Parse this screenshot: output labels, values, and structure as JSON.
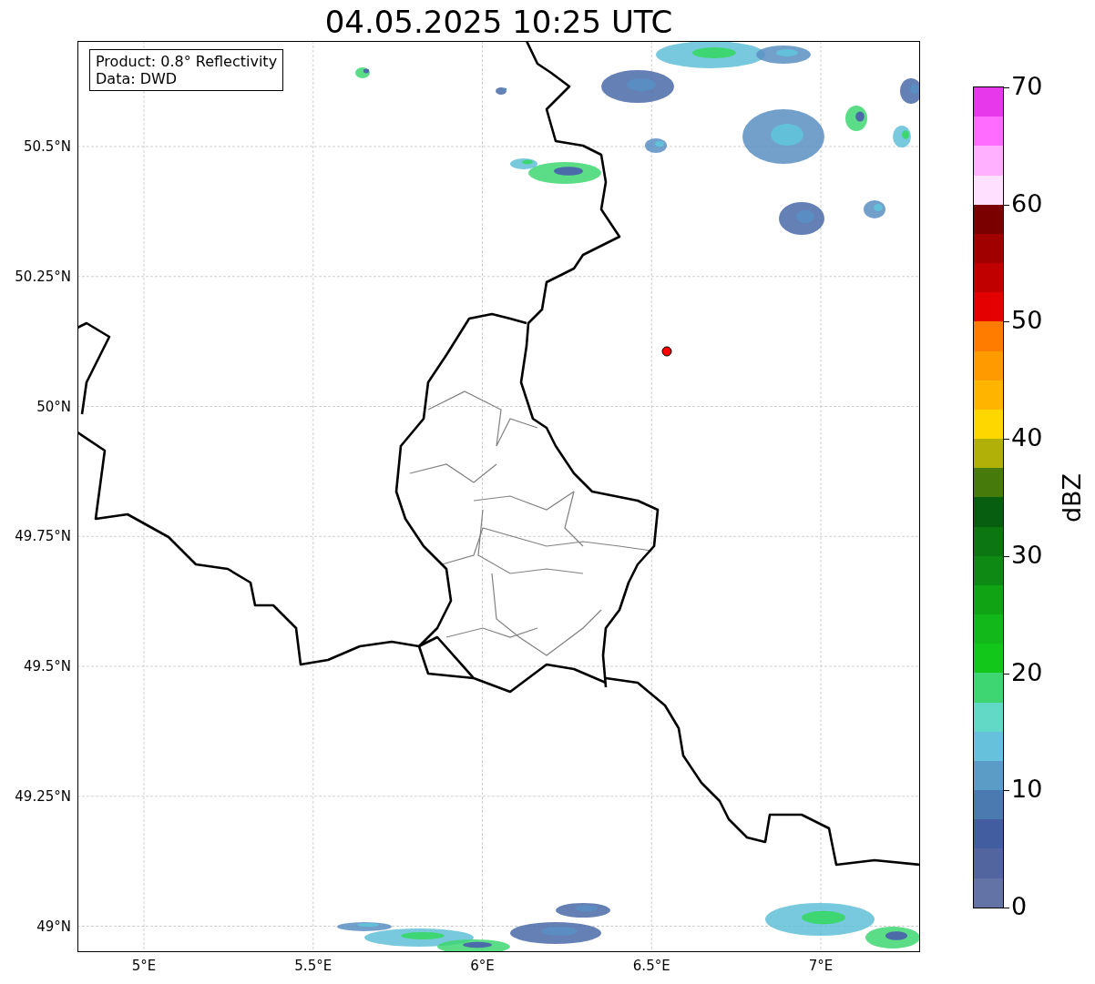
{
  "title": "04.05.2025 10:25 UTC",
  "info_box": {
    "lines": [
      "Product: 0.8° Reflectivity",
      "Data: DWD"
    ]
  },
  "y_ticks": [
    "50.5°N",
    "50.25°N",
    "50°N",
    "49.75°N",
    "49.5°N",
    "49.25°N",
    "49°N"
  ],
  "x_ticks": [
    "5°E",
    "5.5°E",
    "6°E",
    "6.5°E",
    "7°E"
  ],
  "colorbar": {
    "label": "dBZ",
    "ticks": [
      "70",
      "60",
      "50",
      "40",
      "30",
      "20",
      "10",
      "0"
    ],
    "bins": [
      {
        "color": "#6473a6"
      },
      {
        "color": "#52659f"
      },
      {
        "color": "#435ea0"
      },
      {
        "color": "#4a7ab0"
      },
      {
        "color": "#5b9cc7"
      },
      {
        "color": "#66c2dc"
      },
      {
        "color": "#62d8c6"
      },
      {
        "color": "#3ed672"
      },
      {
        "color": "#12c61a"
      },
      {
        "color": "#12b81a"
      },
      {
        "color": "#10a414"
      },
      {
        "color": "#0e8a14"
      },
      {
        "color": "#0b7612"
      },
      {
        "color": "#085e10"
      },
      {
        "color": "#467a0a"
      },
      {
        "color": "#b0b008"
      },
      {
        "color": "#ffd700"
      },
      {
        "color": "#ffb400"
      },
      {
        "color": "#ff9a00"
      },
      {
        "color": "#ff7c00"
      },
      {
        "color": "#e40000"
      },
      {
        "color": "#c00000"
      },
      {
        "color": "#a00000"
      },
      {
        "color": "#7a0000"
      },
      {
        "color": "#ffe0ff"
      },
      {
        "color": "#ffb0ff"
      },
      {
        "color": "#ff6cff"
      },
      {
        "color": "#e838ec"
      }
    ]
  }
}
